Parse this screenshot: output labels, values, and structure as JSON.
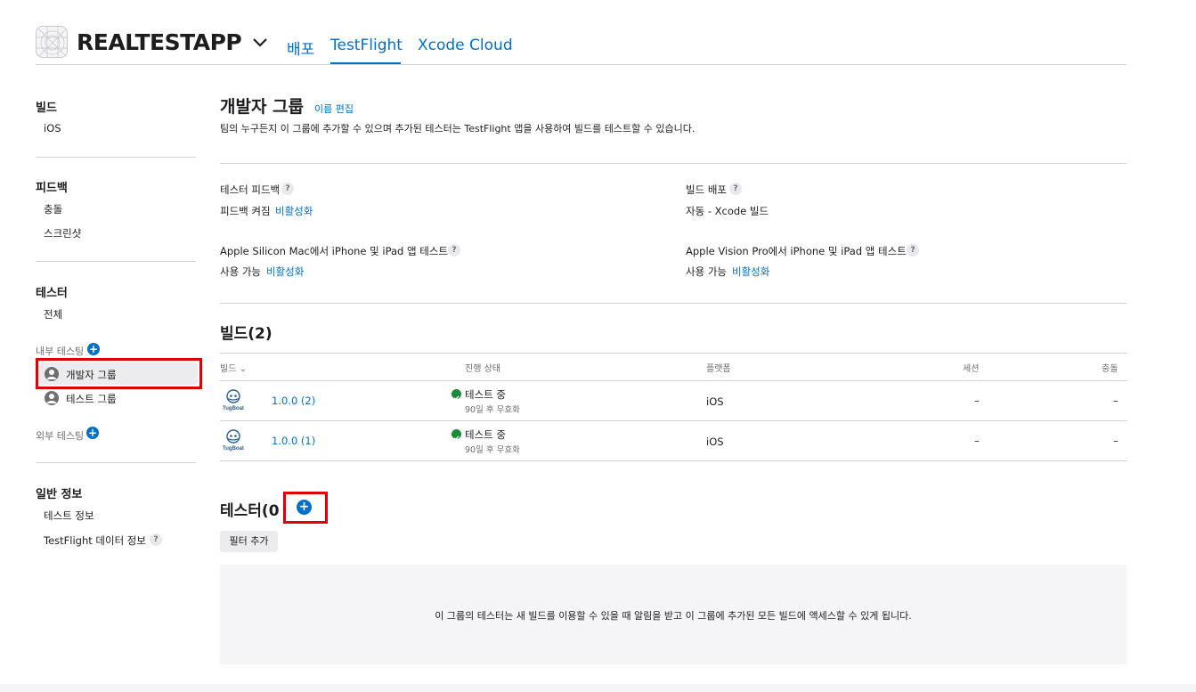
{
  "header": {
    "app_name": "REALTESTAPP",
    "tabs": [
      {
        "label": "배포"
      },
      {
        "label": "TestFlight"
      },
      {
        "label": "Xcode Cloud"
      }
    ],
    "active_tab": "TestFlight"
  },
  "sidebar": {
    "builds": {
      "title": "빌드",
      "items": [
        "iOS"
      ]
    },
    "feedback": {
      "title": "피드백",
      "items": [
        "충돌",
        "스크린샷"
      ]
    },
    "testers": {
      "title": "테스터",
      "all": "전체",
      "internal_label": "내부 테스팅",
      "internal_groups": [
        "개발자 그룹",
        "테스트 그룹"
      ],
      "selected_group": "개발자 그룹",
      "external_label": "외부 테스팅"
    },
    "general": {
      "title": "일반 정보",
      "items": [
        "테스트 정보",
        "TestFlight 데이터 정보"
      ]
    }
  },
  "main": {
    "title": "개발자 그룹",
    "edit_name": "이름 편집",
    "description": "팀의 누구든지 이 그룹에 추가할 수 있으며 추가된 테스터는 TestFlight 앱을 사용하여 빌드를 테스트할 수 있습니다.",
    "settings": {
      "tester_feedback": {
        "label": "테스터 피드백",
        "value": "피드백 켜짐",
        "action": "비활성화"
      },
      "build_distribution": {
        "label": "빌드 배포",
        "value": "자동 - Xcode 빌드"
      },
      "mac_test": {
        "label": "Apple Silicon Mac에서 iPhone 및 iPad 앱 테스트",
        "value": "사용 가능",
        "action": "비활성화"
      },
      "vision_test": {
        "label": "Apple Vision Pro에서 iPhone 및 iPad 앱 테스트",
        "value": "사용 가능",
        "action": "비활성화"
      }
    },
    "builds_section": {
      "title": "빌드(2)",
      "columns": {
        "build": "빌드",
        "status": "진행 상태",
        "platform": "플랫폼",
        "sessions": "세션",
        "crashes": "충돌"
      },
      "rows": [
        {
          "version": "1.0.0 (2)",
          "status": "테스트 중",
          "expiry": "90일 후 무효화",
          "platform": "iOS",
          "sessions": "–",
          "crashes": "–"
        },
        {
          "version": "1.0.0 (1)",
          "status": "테스트 중",
          "expiry": "90일 후 무효화",
          "platform": "iOS",
          "sessions": "–",
          "crashes": "–"
        }
      ]
    },
    "testers_section": {
      "title": "테스터(0",
      "filter_button": "필터 추가",
      "empty_message": "이 그룹의 테스터는 새 빌드를 이용할 수 있을 때 알림을 받고 이 그룹에 추가된 모든 빌드에 액세스할 수 있게 됩니다."
    }
  },
  "icons": {
    "app_icon": "app-icon",
    "dropdown": "chevron-down-icon",
    "add": "plus-circle-icon",
    "help": "question-icon",
    "group": "person-circle-icon",
    "status_ok": "checkmark-circle-icon",
    "build_thumbnail": "tugboat-app-icon"
  },
  "colors": {
    "accent": "#0070c9",
    "highlight_box": "#e30000",
    "status_ok": "#1d8a3a"
  }
}
